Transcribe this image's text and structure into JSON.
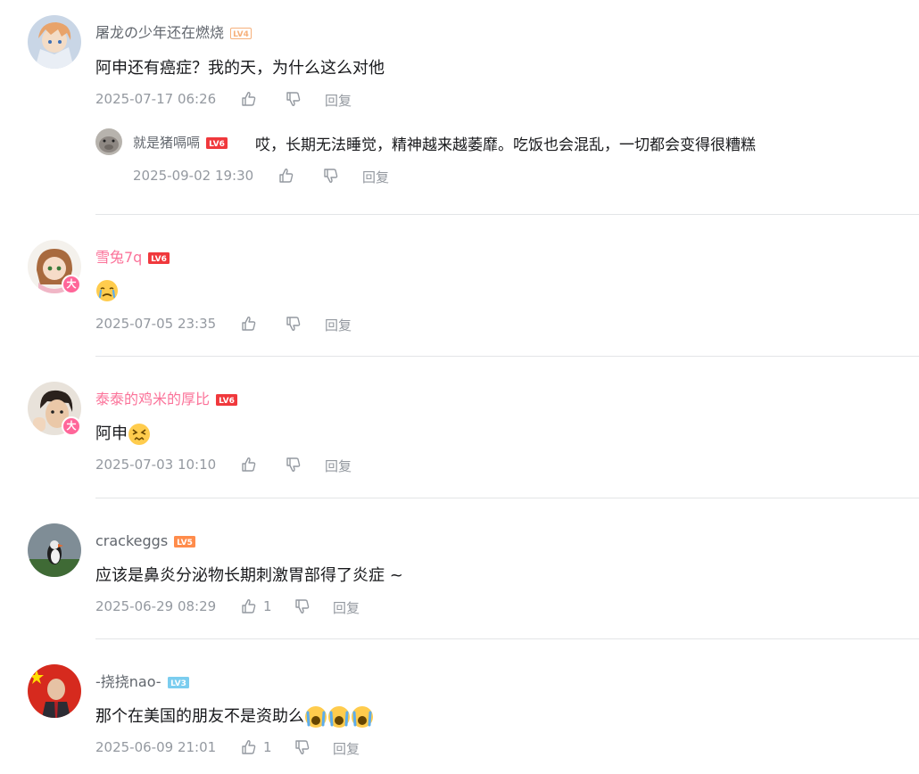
{
  "colors": {
    "accent_pink": "#fb7299",
    "meta_gray": "#9499a0",
    "name_gray": "#61666d",
    "lv4": "#f6b07b",
    "lv5": "#ff8c4b",
    "lv6": "#f0383c",
    "lv3": "#7bcdef"
  },
  "comments": [
    {
      "user": "屠龙の少年还在燃烧",
      "level": "LV4",
      "text": "阿申还有癌症？我的天，为什么这么对他",
      "time": "2025-07-17 06:26",
      "likes": "",
      "reply": "回复",
      "sub_reply": {
        "user": "就是猪嗝嗝",
        "level": "LV6",
        "text": "哎，长期无法睡觉，精神越来越萎靡。吃饭也会混乱，一切都会变得很糟糕",
        "time": "2025-09-02 19:30",
        "reply": "回复"
      }
    },
    {
      "user": "雪兔7q",
      "level": "LV6",
      "vip": "大",
      "text": "",
      "emoji": "crying-face-emoji",
      "time": "2025-07-05 23:35",
      "likes": "",
      "reply": "回复"
    },
    {
      "user": "泰泰的鸡米的厚比",
      "level": "LV6",
      "vip": "大",
      "text": "阿申",
      "emoji": "dizzy-face-emoji",
      "time": "2025-07-03 10:10",
      "likes": "",
      "reply": "回复"
    },
    {
      "user": "crackeggs",
      "level": "LV5",
      "text": "应该是鼻炎分泌物长期刺激胃部得了炎症 ~",
      "time": "2025-06-29 08:29",
      "likes": "1",
      "reply": "回复"
    },
    {
      "user": "-挠挠nao-",
      "level": "LV3",
      "text": "那个在美国的朋友不是资助么",
      "emoji": "wailing-face-emoji",
      "time": "2025-06-09 21:01",
      "likes": "1",
      "reply": "回复"
    }
  ]
}
